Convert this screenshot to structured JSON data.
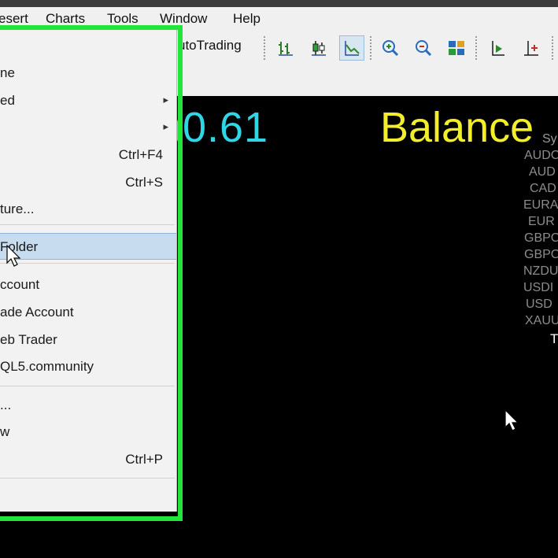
{
  "menubar": {
    "items": [
      "esert",
      "Charts",
      "Tools",
      "Window",
      "Help"
    ]
  },
  "toolbar": {
    "autotrading_label": "utoTrading"
  },
  "chart": {
    "profit_value": ")0.61",
    "balance_label": "Balance",
    "symbol_header": "Sy",
    "symbols": [
      "AUDC",
      "AUD",
      "CAD",
      "EURA",
      "EUR",
      "GBPC",
      "GBPC",
      "NZDU",
      "USDI",
      "USD",
      "XAUU"
    ],
    "total_label": "T"
  },
  "file_menu": {
    "items": [
      {
        "label": "ne",
        "shortcut": "",
        "submenu": false
      },
      {
        "label": "ed",
        "shortcut": "",
        "submenu": true
      },
      {
        "label": "",
        "shortcut": "",
        "submenu": true
      },
      {
        "label": "",
        "shortcut": "Ctrl+F4",
        "submenu": false
      },
      {
        "label": "",
        "shortcut": "Ctrl+S",
        "submenu": false
      },
      {
        "label": "ture...",
        "shortcut": "",
        "submenu": false
      },
      {
        "label": "Folder",
        "shortcut": "",
        "submenu": false,
        "highlighted": true
      },
      {
        "label": "ccount",
        "shortcut": "",
        "submenu": false
      },
      {
        "label": "ade Account",
        "shortcut": "",
        "submenu": false
      },
      {
        "label": "eb Trader",
        "shortcut": "",
        "submenu": false
      },
      {
        "label": "QL5.community",
        "shortcut": "",
        "submenu": false
      },
      {
        "label": "...",
        "shortcut": "",
        "submenu": false
      },
      {
        "label": "w",
        "shortcut": "",
        "submenu": false
      },
      {
        "label": "",
        "shortcut": "Ctrl+P",
        "submenu": false
      }
    ],
    "highlight_color": "#22e53a"
  },
  "icons": [
    "bar-chart-icon",
    "candlestick-icon",
    "line-chart-icon",
    "zoom-in-icon",
    "zoom-out-icon",
    "tile-windows-icon",
    "chart-shift-icon",
    "auto-scroll-icon"
  ]
}
